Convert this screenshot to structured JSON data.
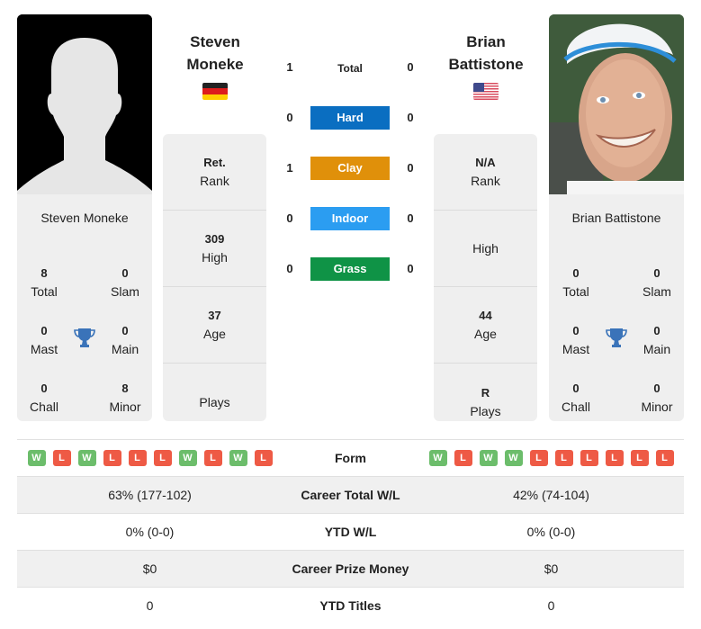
{
  "colors": {
    "hard": "#0a6ec1",
    "clay": "#e0900a",
    "indoor": "#2b9df1",
    "grass": "#0f9346",
    "win": "#6cbd6b",
    "loss": "#ee5a45",
    "trophy": "#3a73b9"
  },
  "player1": {
    "name_line1": "Steven",
    "name_line2": "Moneke",
    "full_name": "Steven Moneke",
    "flag": "germany-flag",
    "photo": "silhouette-placeholder",
    "titles": {
      "total": {
        "value": "8",
        "label": "Total"
      },
      "slam": {
        "value": "0",
        "label": "Slam"
      },
      "mast": {
        "value": "0",
        "label": "Mast"
      },
      "main": {
        "value": "0",
        "label": "Main"
      },
      "chall": {
        "value": "0",
        "label": "Chall"
      },
      "minor": {
        "value": "8",
        "label": "Minor"
      }
    },
    "info": {
      "rank": {
        "value": "Ret.",
        "label": "Rank"
      },
      "high": {
        "value": "309",
        "label": "High"
      },
      "age": {
        "value": "37",
        "label": "Age"
      },
      "plays": {
        "value": "",
        "label": "Plays"
      }
    },
    "form": [
      "W",
      "L",
      "W",
      "L",
      "L",
      "L",
      "W",
      "L",
      "W",
      "L"
    ]
  },
  "player2": {
    "name_line1": "Brian",
    "name_line2": "Battistone",
    "full_name": "Brian Battistone",
    "flag": "usa-flag",
    "photo": "player-photo",
    "titles": {
      "total": {
        "value": "0",
        "label": "Total"
      },
      "slam": {
        "value": "0",
        "label": "Slam"
      },
      "mast": {
        "value": "0",
        "label": "Mast"
      },
      "main": {
        "value": "0",
        "label": "Main"
      },
      "chall": {
        "value": "0",
        "label": "Chall"
      },
      "minor": {
        "value": "0",
        "label": "Minor"
      }
    },
    "info": {
      "rank": {
        "value": "N/A",
        "label": "Rank"
      },
      "high": {
        "value": "",
        "label": "High"
      },
      "age": {
        "value": "44",
        "label": "Age"
      },
      "plays": {
        "value": "R",
        "label": "Plays"
      }
    },
    "form": [
      "W",
      "L",
      "W",
      "W",
      "L",
      "L",
      "L",
      "L",
      "L",
      "L"
    ]
  },
  "h2h": [
    {
      "label": "Total",
      "p1": "1",
      "p2": "0",
      "surface": "total"
    },
    {
      "label": "Hard",
      "p1": "0",
      "p2": "0",
      "surface": "hard"
    },
    {
      "label": "Clay",
      "p1": "1",
      "p2": "0",
      "surface": "clay"
    },
    {
      "label": "Indoor",
      "p1": "0",
      "p2": "0",
      "surface": "indoor"
    },
    {
      "label": "Grass",
      "p1": "0",
      "p2": "0",
      "surface": "grass"
    }
  ],
  "stats": [
    {
      "label": "Form",
      "p1": "",
      "p2": ""
    },
    {
      "label": "Career Total W/L",
      "p1": "63% (177-102)",
      "p2": "42% (74-104)"
    },
    {
      "label": "YTD W/L",
      "p1": "0% (0-0)",
      "p2": "0% (0-0)"
    },
    {
      "label": "Career Prize Money",
      "p1": "$0",
      "p2": "$0"
    },
    {
      "label": "YTD Titles",
      "p1": "0",
      "p2": "0"
    }
  ]
}
